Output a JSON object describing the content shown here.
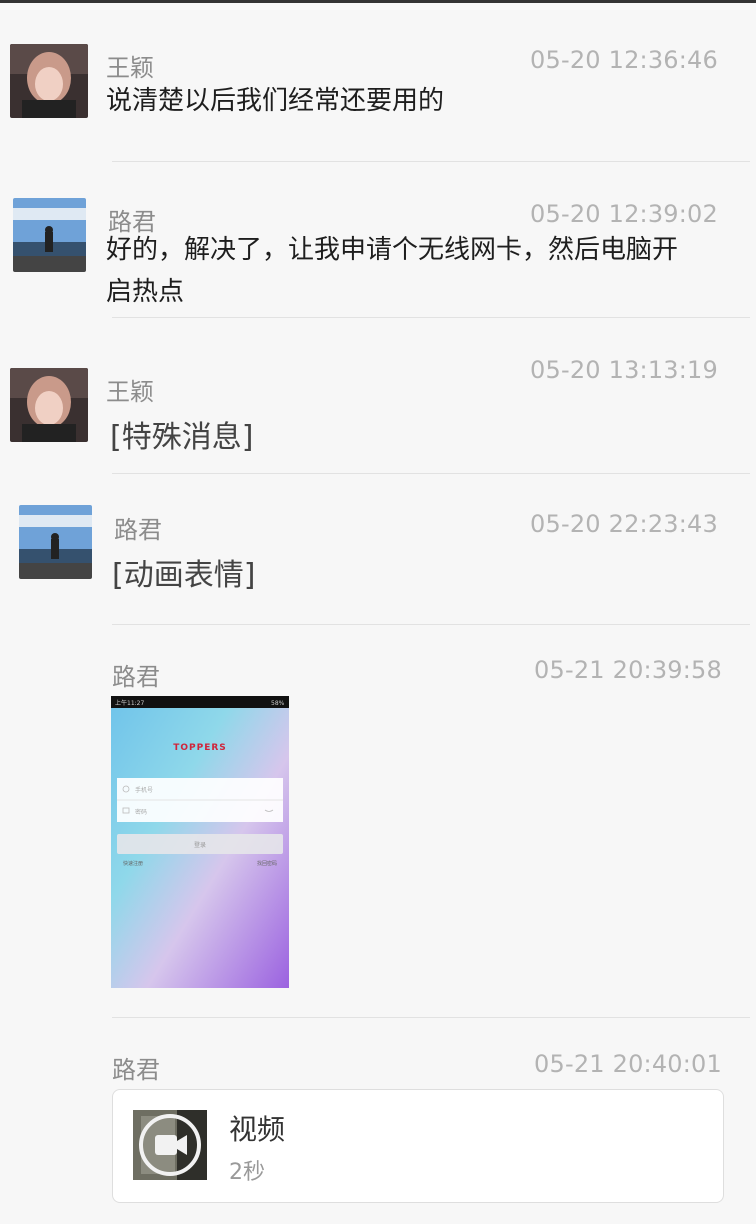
{
  "messages": [
    {
      "sender": "王颖",
      "time": "05-20 12:36:46",
      "text": "说清楚以后我们经常还要用的"
    },
    {
      "sender": "路君",
      "time": "05-20 12:39:02",
      "text_lines": [
        "好的，解决了，让我申请个无线网卡，然后电脑开",
        "启热点"
      ]
    },
    {
      "sender": "王颖",
      "time": "05-20 13:13:19",
      "text": "[特殊消息]"
    },
    {
      "sender": "路君",
      "time": "05-20  22:23:43",
      "text": "[动画表情]"
    },
    {
      "sender": "路君",
      "time": "05-21 20:39:58",
      "image": {
        "app_logo": "TOPPERS",
        "phone_placeholder": "手机号",
        "password_placeholder": "密码",
        "login_button": "登录",
        "register_link": "快速注册",
        "forgot_link": "找回密码",
        "status_time": "上午11:27",
        "battery": "58%"
      }
    },
    {
      "sender": "路君",
      "time": "05-21 20:40:01",
      "video": {
        "title": "视频",
        "duration": "2秒",
        "icon": "video-camera-icon"
      }
    }
  ],
  "colors": {
    "background": "#f7f7f7",
    "name": "#8c8c8c",
    "time": "#b3b3b3",
    "divider": "#e2e2e2"
  }
}
